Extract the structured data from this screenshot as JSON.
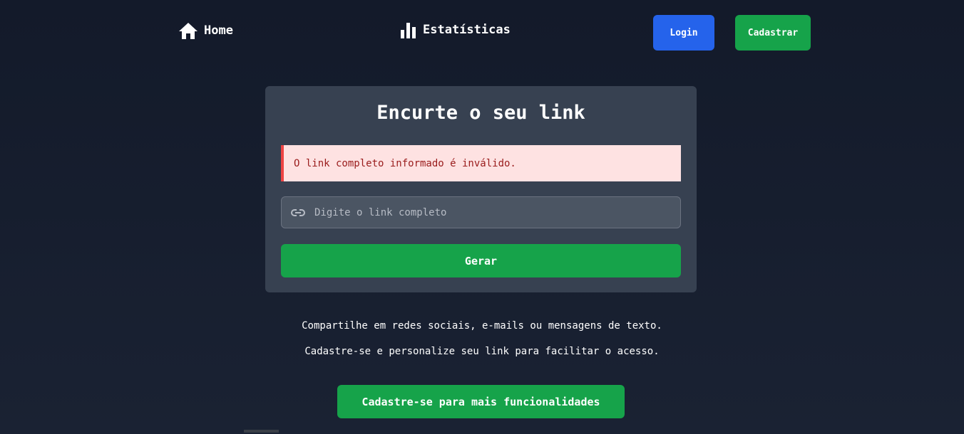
{
  "nav": {
    "home_label": "Home",
    "home_icon": "home-icon",
    "stats_label": "Estatísticas",
    "stats_icon": "bar-chart-icon",
    "login_label": "Login",
    "signup_label": "Cadastrar"
  },
  "card": {
    "title": "Encurte o seu link",
    "alert_text": "O link completo informado é inválido.",
    "input_placeholder": "Digite o link completo",
    "input_value": "",
    "input_icon": "link-icon",
    "generate_label": "Gerar"
  },
  "info": {
    "line1": "Compartilhe em redes sociais, e-mails ou mensagens de texto.",
    "line2": "Cadastre-se e personalize seu link para facilitar o acesso.",
    "cta_label": "Cadastre-se para mais funcionalidades"
  },
  "colors": {
    "background": "#131a2a",
    "card": "#374151",
    "login_button": "#2563eb",
    "primary_green": "#16a34a",
    "alert_bg": "#fee2e2",
    "alert_border": "#ef4444",
    "alert_text": "#991b1b"
  }
}
